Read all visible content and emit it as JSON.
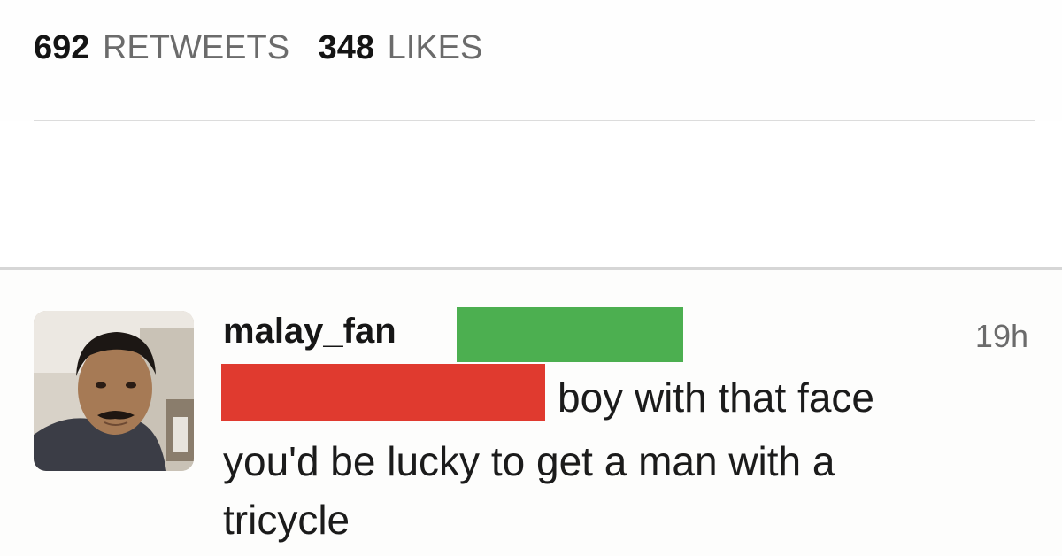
{
  "stats": {
    "retweets_count": "692",
    "retweets_label": "RETWEETS",
    "likes_count": "348",
    "likes_label": "LIKES"
  },
  "reply": {
    "username": "malay_fan",
    "timestamp": "19h",
    "text_lines": [
      "boy with that face",
      "you'd be lucky to get a man with a",
      "tricycle"
    ],
    "redaction_colors": {
      "green": "#4caf50",
      "red": "#e03a2f"
    }
  },
  "colors": {
    "secondary_text": "#6b6b6b",
    "divider": "#dcdcdc"
  }
}
